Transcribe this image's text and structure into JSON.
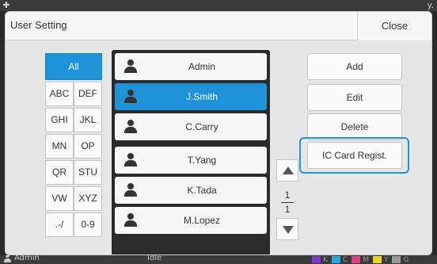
{
  "background": {
    "top_right_fragment": "y.",
    "status": {
      "user": "Admin",
      "state": "Idle",
      "ink": [
        {
          "label": "K",
          "color": "#7a3cc8"
        },
        {
          "label": "C",
          "color": "#29a8e0"
        },
        {
          "label": "M",
          "color": "#e0408a"
        },
        {
          "label": "Y",
          "color": "#f0d020"
        },
        {
          "label": "G",
          "color": "#9a9a9a"
        }
      ]
    }
  },
  "dialog": {
    "title": "User Setting",
    "close_label": "Close",
    "filters": [
      {
        "label": "All",
        "selected": true
      },
      {
        "label": "ABC"
      },
      {
        "label": "DEF"
      },
      {
        "label": "GHI"
      },
      {
        "label": "JKL"
      },
      {
        "label": "MN"
      },
      {
        "label": "OP"
      },
      {
        "label": "QR"
      },
      {
        "label": "STU"
      },
      {
        "label": "VW"
      },
      {
        "label": "XYZ"
      },
      {
        "label": ".-/"
      },
      {
        "label": "0-9"
      }
    ],
    "users": [
      {
        "name": "Admin"
      },
      {
        "name": "J.Smith",
        "selected": true
      },
      {
        "name": "C.Carry"
      },
      {
        "name": "T.Yang"
      },
      {
        "name": "K.Tada"
      },
      {
        "name": "M.Lopez"
      }
    ],
    "pager": {
      "current": "1",
      "total": "1"
    },
    "actions": {
      "add": "Add",
      "edit": "Edit",
      "delete": "Delete",
      "ic_card": "IC Card Regist."
    },
    "accent_color": "#1f93d9"
  }
}
